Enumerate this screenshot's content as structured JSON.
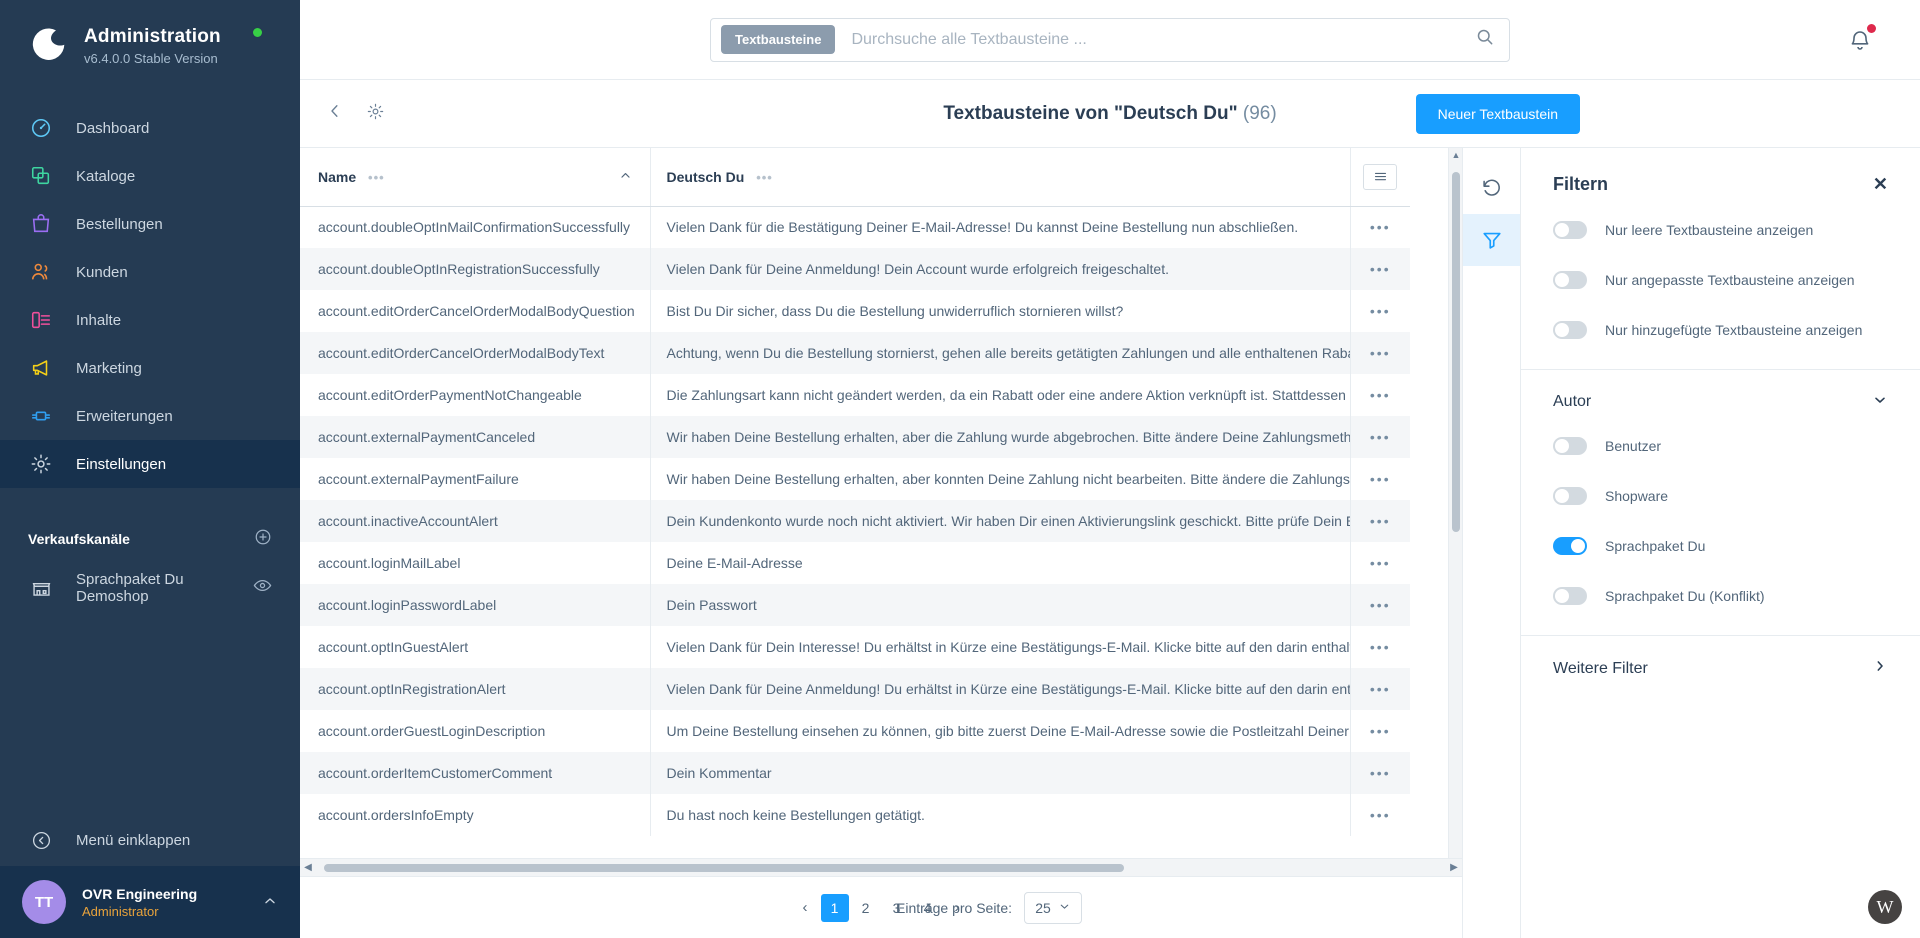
{
  "sidebar": {
    "brand": {
      "title": "Administration",
      "version": "v6.4.0.0 Stable Version"
    },
    "items": [
      {
        "label": "Dashboard",
        "icon": "gauge-icon",
        "color": "#5ec8f5",
        "active": false
      },
      {
        "label": "Kataloge",
        "icon": "catalog-icon",
        "color": "#3ed6a0",
        "active": false
      },
      {
        "label": "Bestellungen",
        "icon": "bag-icon",
        "color": "#9b6ef3",
        "active": false
      },
      {
        "label": "Kunden",
        "icon": "users-icon",
        "color": "#f08a3c",
        "active": false
      },
      {
        "label": "Inhalte",
        "icon": "content-icon",
        "color": "#f0509b",
        "active": false
      },
      {
        "label": "Marketing",
        "icon": "megaphone-icon",
        "color": "#f5d017",
        "active": false
      },
      {
        "label": "Erweiterungen",
        "icon": "plugin-icon",
        "color": "#2f9ef0",
        "active": false
      },
      {
        "label": "Einstellungen",
        "icon": "gear-icon",
        "color": "#cdd7e1",
        "active": true
      }
    ],
    "section_title": "Verkaufskanäle",
    "channels": [
      {
        "label": "Sprachpaket Du Demoshop",
        "icon": "store-icon"
      }
    ],
    "collapse_label": "Menü einklappen",
    "user": {
      "initials": "TT",
      "name": "OVR Engineering",
      "role": "Administrator"
    }
  },
  "topbar": {
    "search_chip": "Textbausteine",
    "search_placeholder": "Durchsuche alle Textbausteine ...",
    "search_value": ""
  },
  "pageheader": {
    "title": "Textbausteine von \"Deutsch Du\"",
    "count": "(96)",
    "primary_button": "Neuer Textbaustein"
  },
  "table": {
    "columns": [
      {
        "label": "Name",
        "sorted": true,
        "sort_dir": "asc"
      },
      {
        "label": "Deutsch Du",
        "sorted": false
      }
    ],
    "rows": [
      {
        "name": "account.doubleOptInMailConfirmationSuccessfully",
        "value": "Vielen Dank für die Bestätigung Deiner E-Mail-Adresse! Du kannst Deine Bestellung nun abschließen."
      },
      {
        "name": "account.doubleOptInRegistrationSuccessfully",
        "value": "Vielen Dank für Deine Anmeldung! Dein Account wurde erfolgreich freigeschaltet."
      },
      {
        "name": "account.editOrderCancelOrderModalBodyQuestion",
        "value": "Bist Du Dir sicher, dass Du die Bestellung unwiderruflich stornieren willst?"
      },
      {
        "name": "account.editOrderCancelOrderModalBodyText",
        "value": "Achtung, wenn Du die Bestellung stornierst, gehen alle bereits getätigten Zahlungen und alle enthaltenen Rabatte und"
      },
      {
        "name": "account.editOrderPaymentNotChangeable",
        "value": "Die Zahlungsart kann nicht geändert werden, da ein Rabatt oder eine andere Aktion verknüpft ist. Stattdessen kannst D"
      },
      {
        "name": "account.externalPaymentCanceled",
        "value": "Wir haben Deine Bestellung erhalten, aber die Zahlung wurde abgebrochen. Bitte ändere Deine Zahlungsmethode ode"
      },
      {
        "name": "account.externalPaymentFailure",
        "value": "Wir haben Deine Bestellung erhalten, aber konnten Deine Zahlung nicht bearbeiten. Bitte ändere die Zahlungsmethod"
      },
      {
        "name": "account.inactiveAccountAlert",
        "value": "Dein Kundenkonto wurde noch nicht aktiviert. Wir haben Dir einen Aktivierungslink geschickt. Bitte prüfe Dein E-Mail-F"
      },
      {
        "name": "account.loginMailLabel",
        "value": "Deine E-Mail-Adresse"
      },
      {
        "name": "account.loginPasswordLabel",
        "value": "Dein Passwort"
      },
      {
        "name": "account.optInGuestAlert",
        "value": "Vielen Dank für Dein Interesse! Du erhältst in Kürze eine Bestätigungs-E-Mail. Klicke bitte auf den darin enthaltenen Lin"
      },
      {
        "name": "account.optInRegistrationAlert",
        "value": "Vielen Dank für Deine Anmeldung! Du erhältst in Kürze eine Bestätigungs-E-Mail. Klicke bitte auf den darin enthaltenen"
      },
      {
        "name": "account.orderGuestLoginDescription",
        "value": "Um Deine Bestellung einsehen zu können, gib bitte zuerst Deine E-Mail-Adresse sowie die Postleitzahl Deiner verwende"
      },
      {
        "name": "account.orderItemCustomerComment",
        "value": "Dein Kommentar"
      },
      {
        "name": "account.ordersInfoEmpty",
        "value": "Du hast noch keine Bestellungen getätigt."
      }
    ],
    "row_action_label": "•••"
  },
  "pagination": {
    "prev": "‹",
    "next": "›",
    "pages": [
      "1",
      "2",
      "3",
      "4"
    ],
    "current": "1",
    "per_page_label": "Einträge pro Seite:",
    "per_page_value": "25"
  },
  "filter_panel": {
    "title": "Filtern",
    "close": "✕",
    "toggles": [
      {
        "label": "Nur leere Textbausteine anzeigen",
        "on": false
      },
      {
        "label": "Nur angepasste Textbausteine anzeigen",
        "on": false
      },
      {
        "label": "Nur hinzugefügte Textbausteine anzeigen",
        "on": false
      }
    ],
    "group": {
      "title": "Autor",
      "expanded": true,
      "options": [
        {
          "label": "Benutzer",
          "on": false
        },
        {
          "label": "Shopware",
          "on": false
        },
        {
          "label": "Sprachpaket Du",
          "on": true
        },
        {
          "label": "Sprachpaket Du (Konflikt)",
          "on": false
        }
      ]
    },
    "more_filters": "Weitere Filter"
  },
  "rail": {
    "reset_icon": "reset-icon",
    "filter_icon": "filter-icon"
  },
  "colors": {
    "accent": "#189eff",
    "sidebar_bg": "#253b53",
    "sidebar_active": "#17314d",
    "text": "#52667a",
    "heading": "#2b3e54",
    "alert": "#de294c"
  }
}
